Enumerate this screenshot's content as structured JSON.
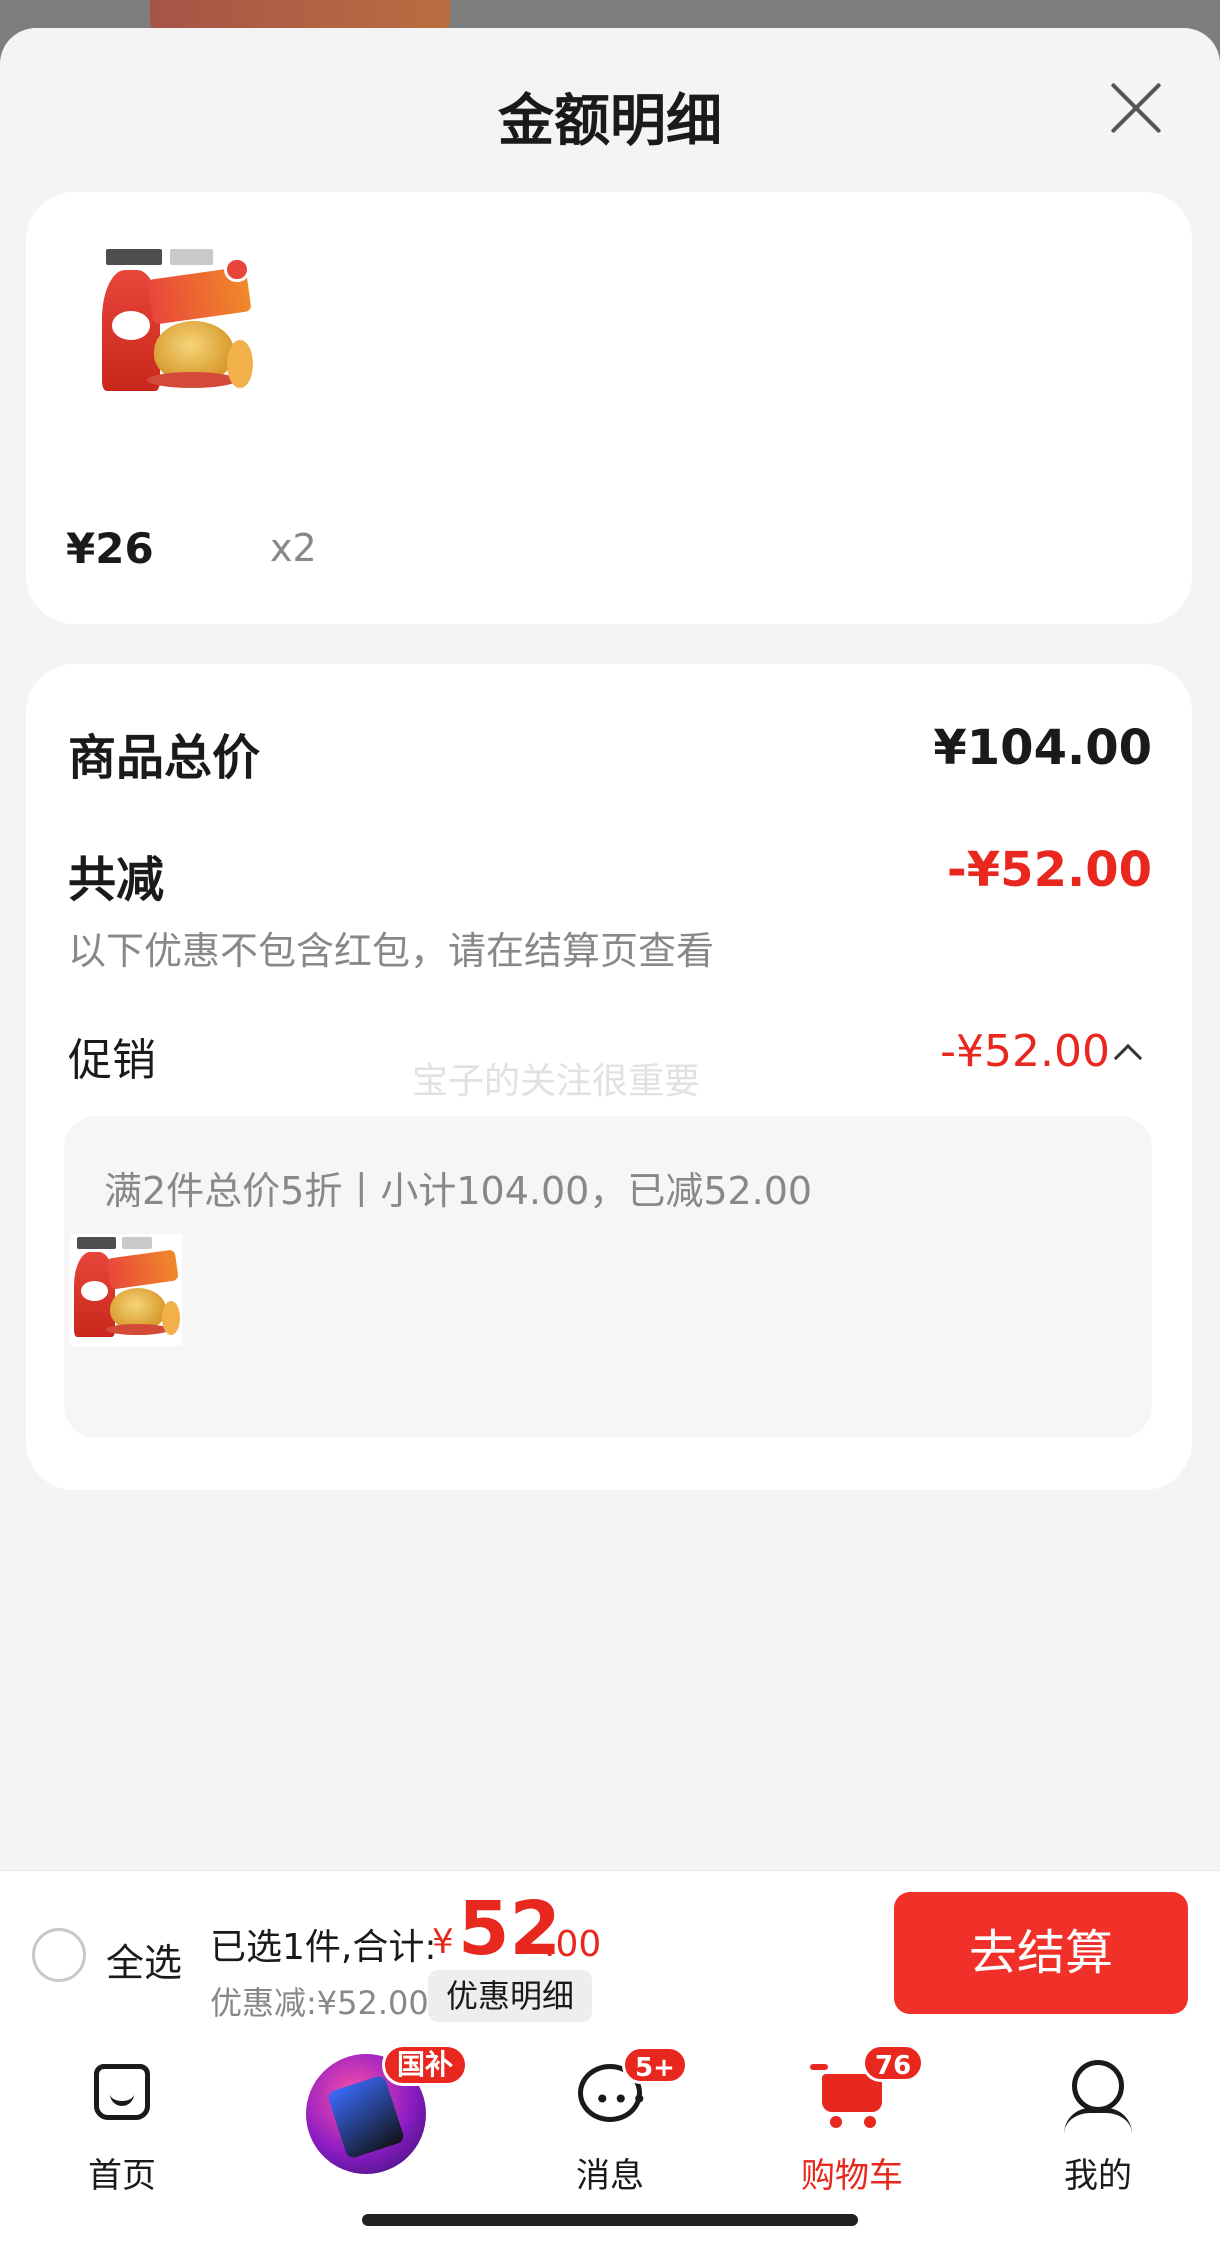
{
  "sheet": {
    "title": "金额明细",
    "close_icon": "close-icon"
  },
  "product": {
    "price": "¥26",
    "quantity": "x2"
  },
  "summary": {
    "total_label": "商品总价",
    "total_value": "¥104.00",
    "reduce_label": "共减",
    "reduce_value": "-¥52.00",
    "note": "以下优惠不包含红包，请在结算页查看",
    "promo_label": "促销",
    "promo_value": "-¥52.00",
    "promo_desc": "满2件总价5折丨小计104.00，已减52.00",
    "watermark": "宝子的关注很重要"
  },
  "checkout": {
    "select_all": "全选",
    "selected_text": "已选1件,合计:",
    "currency": "¥",
    "amount_int": "52",
    "amount_dec": ".00",
    "discount_text": "优惠减:¥52.00",
    "detail_button": "优惠明细",
    "checkout_button": "去结算"
  },
  "tabbar": {
    "home": "首页",
    "gb_badge": "国补",
    "messages": "消息",
    "messages_badge": "5+",
    "cart": "购物车",
    "cart_badge": "76",
    "me": "我的"
  },
  "colors": {
    "accent": "#e8281e",
    "checkout_button": "#f2302a",
    "background": "#f4f4f4"
  }
}
